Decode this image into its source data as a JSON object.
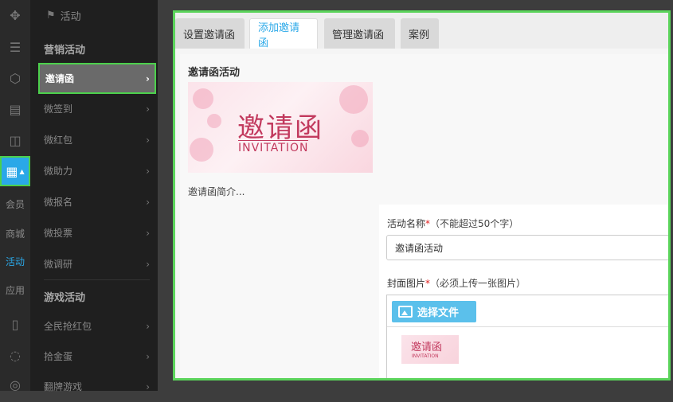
{
  "rail": {
    "icons": [
      "puzzle-icon",
      "list-icon",
      "cube-icon",
      "document-icon",
      "bag-icon",
      "grid-icon",
      "phone-icon",
      "chat-icon",
      "compass-icon"
    ],
    "links": [
      "会员",
      "商城",
      "活动",
      "应用"
    ]
  },
  "nav": {
    "header": "活动",
    "group1": "营销活动",
    "items1": [
      "邀请函",
      "微签到",
      "微红包",
      "微助力",
      "微报名",
      "微投票",
      "微调研"
    ],
    "group2": "游戏活动",
    "items2": [
      "全民抢红包",
      "拾金蛋",
      "翻牌游戏"
    ]
  },
  "tabs": [
    "设置邀请函",
    "添加邀请函",
    "管理邀请函",
    "案例"
  ],
  "preview": {
    "title": "邀请函活动",
    "banner_cn": "邀请函",
    "banner_en": "INVITATION",
    "intro": "邀请函简介..."
  },
  "form": {
    "name_label": "活动名称",
    "name_hint": "（不能超过50个字）",
    "name_value": "邀请函活动",
    "cover_label": "封面图片",
    "cover_hint": "（必须上传一张图片）",
    "pick_button": "选择文件",
    "required_mark": "*"
  },
  "colors": {
    "accent": "#2aa8e8",
    "highlight": "#4cd04c",
    "required": "#e02020",
    "upload_button": "#5bc0eb"
  }
}
